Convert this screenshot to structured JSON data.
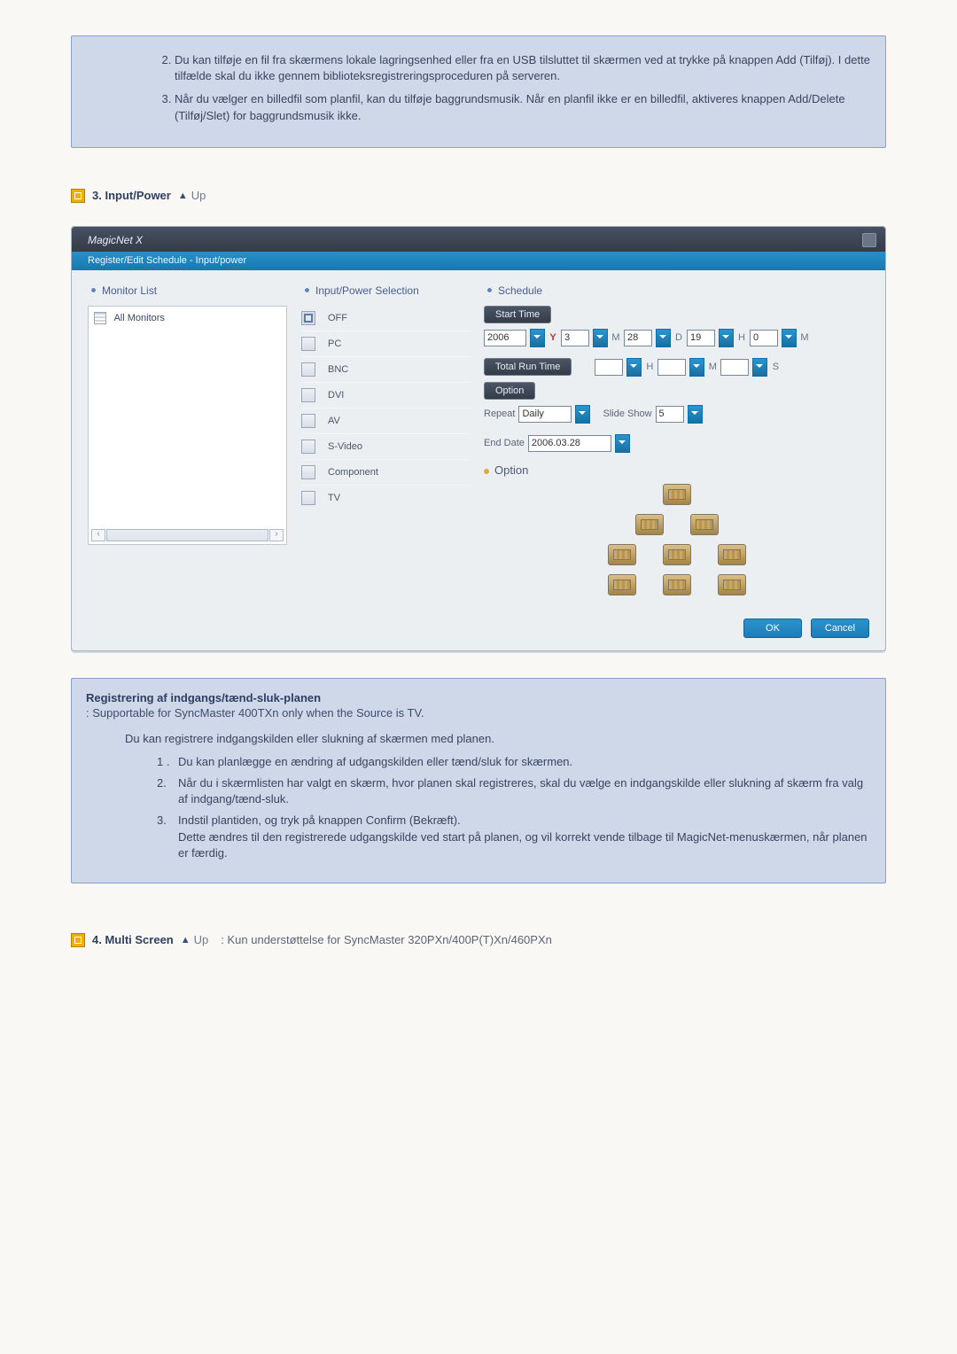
{
  "top_notes": {
    "items": [
      "Du kan tilføje en fil fra skærmens lokale lagringsenhed eller fra en USB tilsluttet til skærmen ved at trykke på knappen Add (Tilføj). I dette tilfælde skal du ikke gennem biblioteksregistreringsproceduren på serveren.",
      "Når du vælger en billedfil som planfil, kan du tilføje baggrundsmusik. Når en planfil ikke er en billedfil, aktiveres knappen Add/Delete (Tilføj/Slet) for baggrundsmusik ikke."
    ]
  },
  "section3": {
    "heading": "3. Input/Power",
    "up": "Up"
  },
  "dialog": {
    "app_title": "MagicNet X",
    "subtitle": "Register/Edit Schedule - Input/power",
    "monitor": {
      "title": "Monitor List",
      "root": "All Monitors"
    },
    "inputs": {
      "title": "Input/Power Selection",
      "items": [
        "OFF",
        "PC",
        "BNC",
        "DVI",
        "AV",
        "S-Video",
        "Component",
        "TV"
      ]
    },
    "schedule": {
      "title": "Schedule",
      "start_chip": "Start Time",
      "start": {
        "year": "2006",
        "y": "Y",
        "m1": "3",
        "m1l": "M",
        "d": "28",
        "dl": "D",
        "h": "19",
        "hl": "H",
        "mm": "0",
        "mml": "M"
      },
      "total_chip": "Total Run Time",
      "total": {
        "h": "",
        "hl": "H",
        "m": "",
        "ml": "M",
        "s": "",
        "sl": "S"
      },
      "option_chip": "Option",
      "repeat_label": "Repeat",
      "repeat_value": "Daily",
      "slide_label": "Slide Show",
      "slide_value": "5",
      "enddate_label": "End Date",
      "enddate_value": "2006.03.28",
      "option_sub": "Option"
    },
    "buttons": {
      "ok": "OK",
      "cancel": "Cancel"
    }
  },
  "section3_notes": {
    "title": "Registrering af indgangs/tænd-sluk-planen",
    "subnote": ": Supportable for SyncMaster 400TXn only when the Source is TV.",
    "intro": "Du kan registrere indgangskilden eller slukning af skærmen med planen.",
    "items": [
      {
        "n": "1 .",
        "t": "Du kan planlægge en ændring af udgangskilden eller tænd/sluk for skærmen."
      },
      {
        "n": "2.",
        "t": "Når du i skærmlisten har valgt en skærm, hvor planen skal registreres, skal du vælge en indgangskilde eller slukning af skærm fra valg af indgang/tænd-sluk."
      },
      {
        "n": "3.",
        "t": "Indstil plantiden, og tryk på knappen Confirm (Bekræft).\nDette ændres til den registrerede udgangskilde ved start på planen, og vil korrekt vende tilbage til MagicNet-menuskærmen, når planen er færdig."
      }
    ]
  },
  "section4": {
    "heading": "4. Multi Screen",
    "up": "Up",
    "support": ": Kun understøttelse for SyncMaster 320PXn/400P(T)Xn/460PXn"
  }
}
